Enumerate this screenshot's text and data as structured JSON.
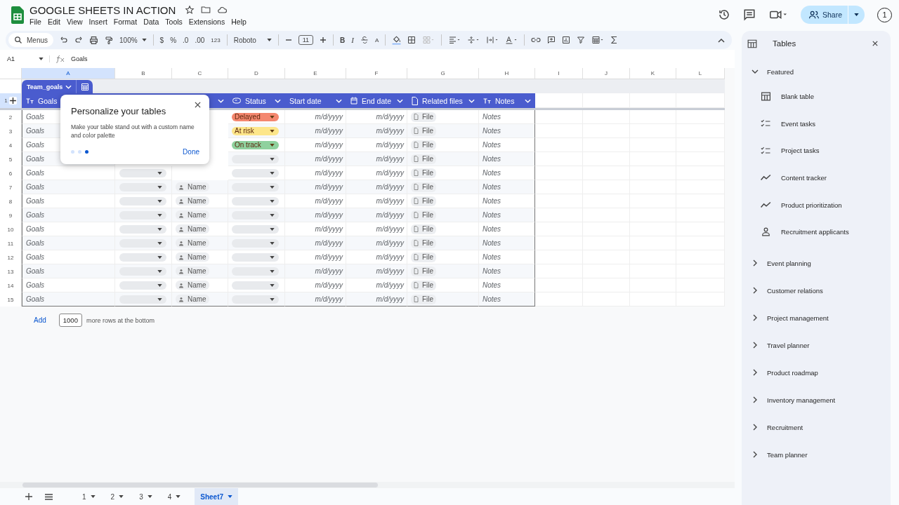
{
  "document": {
    "title": "GOOGLE SHEETS IN ACTION"
  },
  "menu": [
    "File",
    "Edit",
    "View",
    "Insert",
    "Format",
    "Data",
    "Tools",
    "Extensions",
    "Help"
  ],
  "account": {
    "label": "1"
  },
  "share": {
    "label": "Share"
  },
  "toolbar": {
    "search_label": "Menus",
    "zoom": "100%",
    "currency": "$",
    "percent": "%",
    "decrease_decimal": ".0",
    "increase_decimal": ".00",
    "number_format": "123",
    "font": "Roboto",
    "font_size": "11",
    "bold": "B",
    "italic": "I",
    "text_color": "A"
  },
  "formula_bar": {
    "cell": "A1",
    "content": "Goals"
  },
  "columns": [
    {
      "letter": "A",
      "selected": true
    },
    {
      "letter": "B",
      "selected": false
    },
    {
      "letter": "C",
      "selected": false
    },
    {
      "letter": "D",
      "selected": false
    },
    {
      "letter": "E",
      "selected": false
    },
    {
      "letter": "F",
      "selected": false
    },
    {
      "letter": "G",
      "selected": false
    },
    {
      "letter": "H",
      "selected": false
    },
    {
      "letter": "I",
      "selected": false
    },
    {
      "letter": "J",
      "selected": false
    },
    {
      "letter": "K",
      "selected": false
    },
    {
      "letter": "L",
      "selected": false
    }
  ],
  "table": {
    "name": "Team_goals",
    "header_row": "1",
    "header": [
      {
        "kind": "text",
        "label": "Goals"
      },
      {
        "kind": "blank"
      },
      {
        "kind": "blank",
        "menu": true
      },
      {
        "kind": "status",
        "label": "Status",
        "menu": true
      },
      {
        "kind": "plain",
        "label": "Start date",
        "menu": true
      },
      {
        "kind": "date",
        "label": "End date",
        "menu": true
      },
      {
        "kind": "file",
        "label": "Related files",
        "menu": true
      },
      {
        "kind": "text",
        "label": "Notes",
        "menu": true
      }
    ],
    "rows": [
      {
        "number": "2",
        "goal": "Goals",
        "status": {
          "label": "Delayed",
          "color": "#f4876f"
        },
        "start": "m/d/yyyy",
        "end": "m/d/yyyy",
        "file": "File",
        "notes": "Notes"
      },
      {
        "number": "3",
        "goal": "Goals",
        "status": {
          "label": "At risk",
          "color": "#fde68a"
        },
        "start": "m/d/yyyy",
        "end": "m/d/yyyy",
        "file": "File",
        "notes": "Notes"
      },
      {
        "number": "4",
        "goal": "Goals",
        "status": {
          "label": "On track",
          "color": "#8fd19e"
        },
        "start": "m/d/yyyy",
        "end": "m/d/yyyy",
        "file": "File",
        "notes": "Notes"
      },
      {
        "number": "5",
        "goal": "Goals",
        "status": {
          "color": "#e8eaed"
        },
        "start": "m/d/yyyy",
        "end": "m/d/yyyy",
        "file": "File",
        "notes": "Notes"
      },
      {
        "number": "6",
        "goal": "Goals",
        "category": true,
        "status": {
          "color": "#e8eaed"
        },
        "start": "m/d/yyyy",
        "end": "m/d/yyyy",
        "file": "File",
        "notes": "Notes"
      },
      {
        "number": "7",
        "goal": "Goals",
        "category": true,
        "owner": "Name",
        "status": {
          "color": "#e8eaed"
        },
        "start": "m/d/yyyy",
        "end": "m/d/yyyy",
        "file": "File",
        "notes": "Notes"
      },
      {
        "number": "8",
        "goal": "Goals",
        "category": true,
        "owner": "Name",
        "status": {
          "color": "#e8eaed"
        },
        "start": "m/d/yyyy",
        "end": "m/d/yyyy",
        "file": "File",
        "notes": "Notes"
      },
      {
        "number": "9",
        "goal": "Goals",
        "category": true,
        "owner": "Name",
        "status": {
          "color": "#e8eaed"
        },
        "start": "m/d/yyyy",
        "end": "m/d/yyyy",
        "file": "File",
        "notes": "Notes"
      },
      {
        "number": "10",
        "goal": "Goals",
        "category": true,
        "owner": "Name",
        "status": {
          "color": "#e8eaed"
        },
        "start": "m/d/yyyy",
        "end": "m/d/yyyy",
        "file": "File",
        "notes": "Notes"
      },
      {
        "number": "11",
        "goal": "Goals",
        "category": true,
        "owner": "Name",
        "status": {
          "color": "#e8eaed"
        },
        "start": "m/d/yyyy",
        "end": "m/d/yyyy",
        "file": "File",
        "notes": "Notes"
      },
      {
        "number": "12",
        "goal": "Goals",
        "category": true,
        "owner": "Name",
        "status": {
          "color": "#e8eaed"
        },
        "start": "m/d/yyyy",
        "end": "m/d/yyyy",
        "file": "File",
        "notes": "Notes"
      },
      {
        "number": "13",
        "goal": "Goals",
        "category": true,
        "owner": "Name",
        "status": {
          "color": "#e8eaed"
        },
        "start": "m/d/yyyy",
        "end": "m/d/yyyy",
        "file": "File",
        "notes": "Notes"
      },
      {
        "number": "14",
        "goal": "Goals",
        "category": true,
        "owner": "Name",
        "status": {
          "color": "#e8eaed"
        },
        "start": "m/d/yyyy",
        "end": "m/d/yyyy",
        "file": "File",
        "notes": "Notes"
      },
      {
        "number": "15",
        "goal": "Goals",
        "category": true,
        "owner": "Name",
        "status": {
          "color": "#e8eaed"
        },
        "start": "m/d/yyyy",
        "end": "m/d/yyyy",
        "file": "File",
        "notes": "Notes"
      }
    ]
  },
  "popup": {
    "title": "Personalize your tables",
    "body": "Make your table stand out with a custom name and color palette",
    "steps": [
      {
        "selected": false
      },
      {
        "selected": false
      },
      {
        "selected": true
      }
    ],
    "button": "Done"
  },
  "add_rows": {
    "button": "Add",
    "count": "1000",
    "suffix": "more rows at the bottom"
  },
  "sheet_tabs": [
    {
      "label": "1",
      "selected": false
    },
    {
      "label": "2",
      "selected": false
    },
    {
      "label": "3",
      "selected": false
    },
    {
      "label": "4",
      "selected": false
    },
    {
      "label": "Sheet7",
      "selected": true
    }
  ],
  "side_panel": {
    "title": "Tables",
    "sections": [
      {
        "label": "Featured",
        "expanded": true,
        "items": [
          {
            "kind": "table",
            "label": "Blank table"
          },
          {
            "kind": "checklist",
            "label": "Event tasks"
          },
          {
            "kind": "checklist",
            "label": "Project tasks"
          },
          {
            "kind": "trend",
            "label": "Content tracker"
          },
          {
            "kind": "trend",
            "label": "Product prioritization"
          },
          {
            "kind": "person",
            "label": "Recruitment applicants"
          }
        ]
      },
      {
        "label": "Event planning",
        "expanded": false
      },
      {
        "label": "Customer relations",
        "expanded": false
      },
      {
        "label": "Project management",
        "expanded": false
      },
      {
        "label": "Travel planner",
        "expanded": false
      },
      {
        "label": "Product roadmap",
        "expanded": false
      },
      {
        "label": "Inventory management",
        "expanded": false
      },
      {
        "label": "Recruitment",
        "expanded": false
      },
      {
        "label": "Team planner",
        "expanded": false
      }
    ]
  }
}
